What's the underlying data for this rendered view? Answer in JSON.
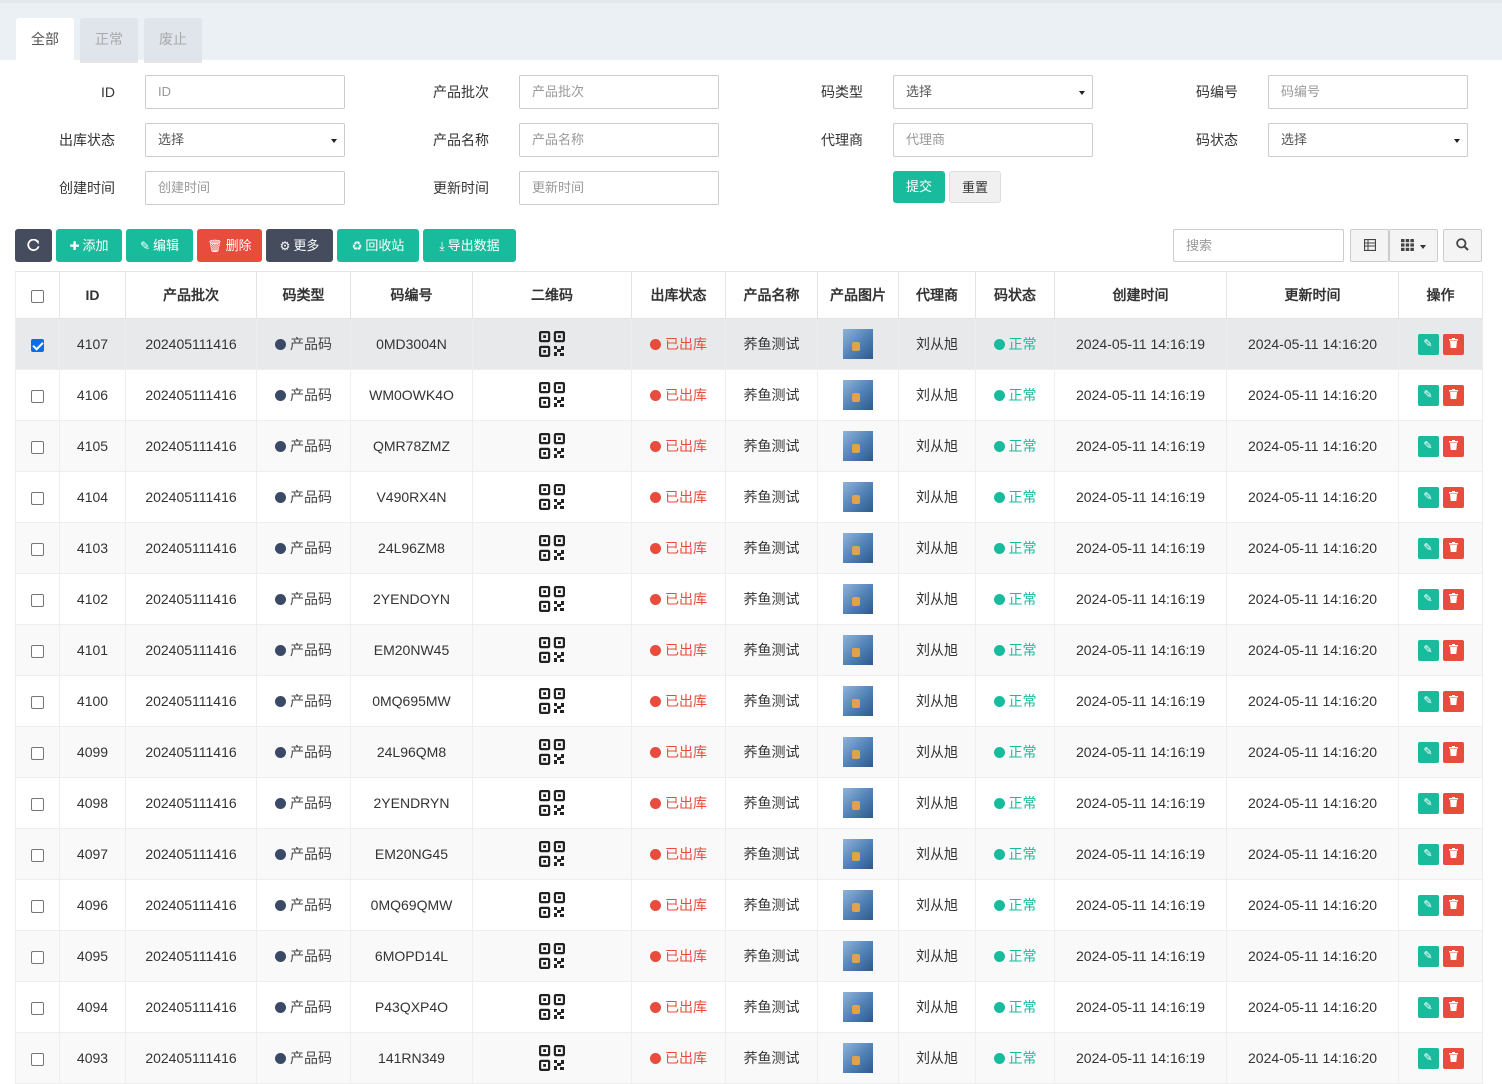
{
  "tabs": [
    "全部",
    "正常",
    "废止"
  ],
  "form": {
    "id_label": "ID",
    "id_placeholder": "ID",
    "batch_label": "产品批次",
    "batch_placeholder": "产品批次",
    "codetype_label": "码类型",
    "codetype_value": "选择",
    "codeno_label": "码编号",
    "codeno_placeholder": "码编号",
    "outstatus_label": "出库状态",
    "outstatus_value": "选择",
    "pname_label": "产品名称",
    "pname_placeholder": "产品名称",
    "agent_label": "代理商",
    "agent_placeholder": "代理商",
    "codestatus_label": "码状态",
    "codestatus_value": "选择",
    "ctime_label": "创建时间",
    "ctime_placeholder": "创建时间",
    "utime_label": "更新时间",
    "utime_placeholder": "更新时间",
    "submit": "提交",
    "reset": "重置"
  },
  "toolbar": {
    "add": "添加",
    "edit": "编辑",
    "delete": "删除",
    "more": "更多",
    "recycle": "回收站",
    "export": "导出数据",
    "search_placeholder": "搜索"
  },
  "colors": {
    "primary": "#18bc9c",
    "danger": "#e74c3c",
    "dark": "#444c5e",
    "type_dot": "#3a4a66"
  },
  "table": {
    "headers": [
      "ID",
      "产品批次",
      "码类型",
      "码编号",
      "二维码",
      "出库状态",
      "产品名称",
      "产品图片",
      "代理商",
      "码状态",
      "创建时间",
      "更新时间",
      "操作"
    ],
    "rows": [
      {
        "id": "4107",
        "batch": "202405111416",
        "type": "产品码",
        "code": "0MD3004N",
        "out": "已出库",
        "name": "荞鱼测试",
        "agent": "刘从旭",
        "status": "正常",
        "created": "2024-05-11 14:16:19",
        "updated": "2024-05-11 14:16:20",
        "checked": true
      },
      {
        "id": "4106",
        "batch": "202405111416",
        "type": "产品码",
        "code": "WM0OWK4O",
        "out": "已出库",
        "name": "荞鱼测试",
        "agent": "刘从旭",
        "status": "正常",
        "created": "2024-05-11 14:16:19",
        "updated": "2024-05-11 14:16:20",
        "checked": false
      },
      {
        "id": "4105",
        "batch": "202405111416",
        "type": "产品码",
        "code": "QMR78ZMZ",
        "out": "已出库",
        "name": "荞鱼测试",
        "agent": "刘从旭",
        "status": "正常",
        "created": "2024-05-11 14:16:19",
        "updated": "2024-05-11 14:16:20",
        "checked": false
      },
      {
        "id": "4104",
        "batch": "202405111416",
        "type": "产品码",
        "code": "V490RX4N",
        "out": "已出库",
        "name": "荞鱼测试",
        "agent": "刘从旭",
        "status": "正常",
        "created": "2024-05-11 14:16:19",
        "updated": "2024-05-11 14:16:20",
        "checked": false
      },
      {
        "id": "4103",
        "batch": "202405111416",
        "type": "产品码",
        "code": "24L96ZM8",
        "out": "已出库",
        "name": "荞鱼测试",
        "agent": "刘从旭",
        "status": "正常",
        "created": "2024-05-11 14:16:19",
        "updated": "2024-05-11 14:16:20",
        "checked": false
      },
      {
        "id": "4102",
        "batch": "202405111416",
        "type": "产品码",
        "code": "2YENDOYN",
        "out": "已出库",
        "name": "荞鱼测试",
        "agent": "刘从旭",
        "status": "正常",
        "created": "2024-05-11 14:16:19",
        "updated": "2024-05-11 14:16:20",
        "checked": false
      },
      {
        "id": "4101",
        "batch": "202405111416",
        "type": "产品码",
        "code": "EM20NW45",
        "out": "已出库",
        "name": "荞鱼测试",
        "agent": "刘从旭",
        "status": "正常",
        "created": "2024-05-11 14:16:19",
        "updated": "2024-05-11 14:16:20",
        "checked": false
      },
      {
        "id": "4100",
        "batch": "202405111416",
        "type": "产品码",
        "code": "0MQ695MW",
        "out": "已出库",
        "name": "荞鱼测试",
        "agent": "刘从旭",
        "status": "正常",
        "created": "2024-05-11 14:16:19",
        "updated": "2024-05-11 14:16:20",
        "checked": false
      },
      {
        "id": "4099",
        "batch": "202405111416",
        "type": "产品码",
        "code": "24L96QM8",
        "out": "已出库",
        "name": "荞鱼测试",
        "agent": "刘从旭",
        "status": "正常",
        "created": "2024-05-11 14:16:19",
        "updated": "2024-05-11 14:16:20",
        "checked": false
      },
      {
        "id": "4098",
        "batch": "202405111416",
        "type": "产品码",
        "code": "2YENDRYN",
        "out": "已出库",
        "name": "荞鱼测试",
        "agent": "刘从旭",
        "status": "正常",
        "created": "2024-05-11 14:16:19",
        "updated": "2024-05-11 14:16:20",
        "checked": false
      },
      {
        "id": "4097",
        "batch": "202405111416",
        "type": "产品码",
        "code": "EM20NG45",
        "out": "已出库",
        "name": "荞鱼测试",
        "agent": "刘从旭",
        "status": "正常",
        "created": "2024-05-11 14:16:19",
        "updated": "2024-05-11 14:16:20",
        "checked": false
      },
      {
        "id": "4096",
        "batch": "202405111416",
        "type": "产品码",
        "code": "0MQ69QMW",
        "out": "已出库",
        "name": "荞鱼测试",
        "agent": "刘从旭",
        "status": "正常",
        "created": "2024-05-11 14:16:19",
        "updated": "2024-05-11 14:16:20",
        "checked": false
      },
      {
        "id": "4095",
        "batch": "202405111416",
        "type": "产品码",
        "code": "6MOPD14L",
        "out": "已出库",
        "name": "荞鱼测试",
        "agent": "刘从旭",
        "status": "正常",
        "created": "2024-05-11 14:16:19",
        "updated": "2024-05-11 14:16:20",
        "checked": false
      },
      {
        "id": "4094",
        "batch": "202405111416",
        "type": "产品码",
        "code": "P43QXP4O",
        "out": "已出库",
        "name": "荞鱼测试",
        "agent": "刘从旭",
        "status": "正常",
        "created": "2024-05-11 14:16:19",
        "updated": "2024-05-11 14:16:20",
        "checked": false
      },
      {
        "id": "4093",
        "batch": "202405111416",
        "type": "产品码",
        "code": "141RN349",
        "out": "已出库",
        "name": "荞鱼测试",
        "agent": "刘从旭",
        "status": "正常",
        "created": "2024-05-11 14:16:19",
        "updated": "2024-05-11 14:16:20",
        "checked": false
      }
    ]
  }
}
